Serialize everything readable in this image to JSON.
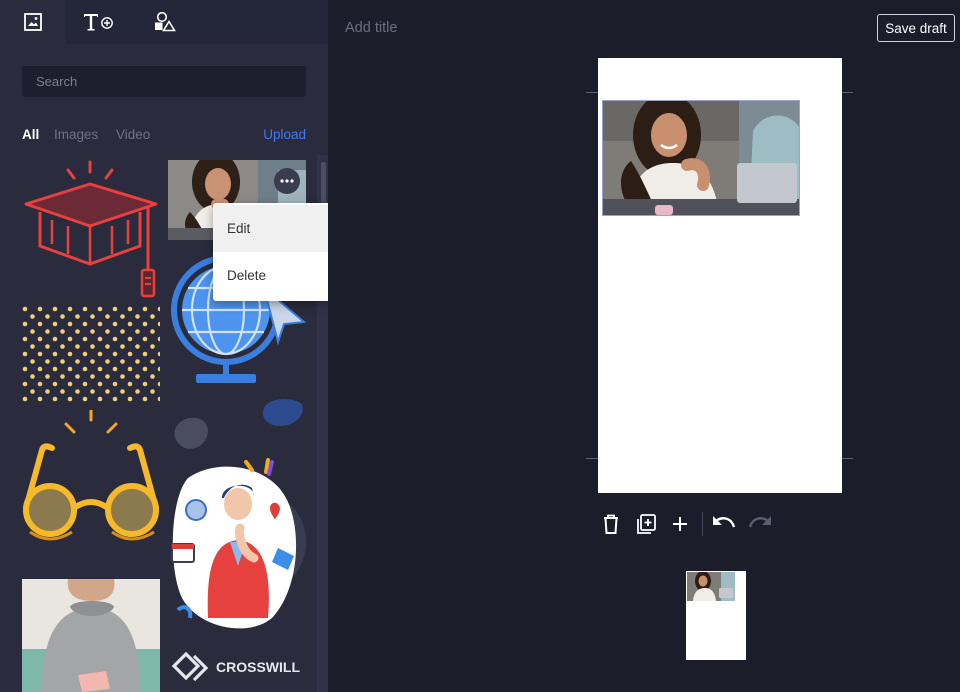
{
  "sidebar": {
    "tabs": [
      {
        "icon": "image-icon",
        "active": true
      },
      {
        "icon": "add-text-icon",
        "active": false
      },
      {
        "icon": "shapes-icon",
        "active": false
      }
    ],
    "search": {
      "placeholder": "Search",
      "value": ""
    },
    "filters": {
      "all": "All",
      "images": "Images",
      "video": "Video",
      "upload": "Upload"
    },
    "assets": [
      "graduation-cap-icon",
      "woman-photo",
      "globe-icon",
      "dot-pattern",
      "blob-shape",
      "glasses-icon",
      "thinking-man-illustration",
      "sweater-woman-photo",
      "crosswill-logo"
    ],
    "logo_text": "CROSSWILL",
    "more_button_icon": "ellipsis-icon",
    "context_menu": {
      "edit": "Edit",
      "delete": "Delete"
    }
  },
  "editor": {
    "title": {
      "placeholder": "Add title",
      "value": ""
    },
    "save_label": "Save draft",
    "toolbar": [
      "trash-icon",
      "duplicate-page-icon",
      "add-icon",
      "undo-icon",
      "redo-icon"
    ]
  },
  "colors": {
    "app_background": "#1c1d2b",
    "panel_background": "#2a2c3d",
    "accent": "#3d7bf4",
    "page": "#ffffff"
  }
}
